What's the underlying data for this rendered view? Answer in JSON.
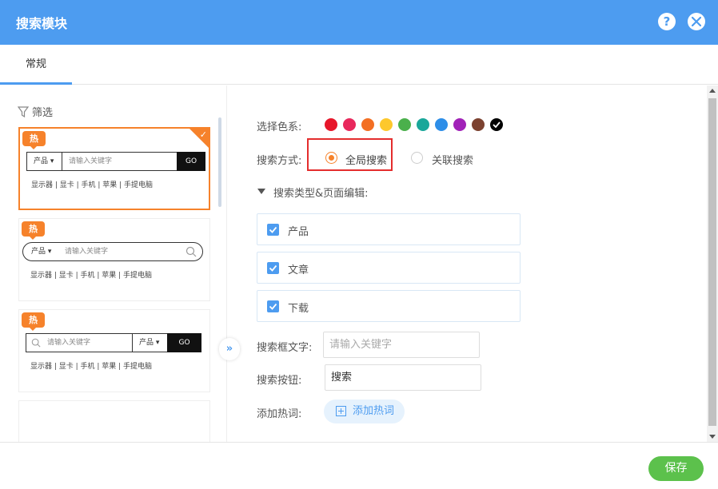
{
  "header": {
    "title": "搜索模块",
    "help_label": "?"
  },
  "tabs": [
    {
      "label": "常规"
    }
  ],
  "left": {
    "filter_label": "筛选",
    "templates": [
      {
        "hot": "热",
        "category": "产品 ▾",
        "placeholder": "请输入关键字",
        "button": "GO",
        "hotwords": "显示器 | 显卡 | 手机 | 苹果 | 手提电脑",
        "selected": true
      },
      {
        "hot": "热",
        "category": "产品 ▾",
        "placeholder": "请输入关键字",
        "hotwords": "显示器 | 显卡 | 手机 | 苹果 | 手提电脑"
      },
      {
        "hot": "热",
        "category": "产品 ▾",
        "placeholder": "请输入关键字",
        "button": "GO",
        "hotwords": "显示器 | 显卡 | 手机 | 苹果 | 手提电脑"
      }
    ],
    "collapse_label": "»"
  },
  "form": {
    "color_label": "选择色系:",
    "colors": [
      "#e7162a",
      "#e8285c",
      "#f36f23",
      "#fdc82c",
      "#4bb04c",
      "#1aa79a",
      "#2d8ee8",
      "#a122b8",
      "#7c4230",
      "#000000"
    ],
    "mode_label": "搜索方式:",
    "mode_options": [
      "全局搜索",
      "关联搜索"
    ],
    "mode_selected": "全局搜索",
    "section_label": "搜索类型&页面编辑:",
    "types": [
      "产品",
      "文章",
      "下载"
    ],
    "box_text_label": "搜索框文字:",
    "box_text_placeholder": "请输入关键字",
    "button_label": "搜索按钮:",
    "button_value": "搜索",
    "hot_label": "添加热词:",
    "add_hot_label": "添加热词"
  },
  "footer": {
    "save_label": "保存"
  }
}
